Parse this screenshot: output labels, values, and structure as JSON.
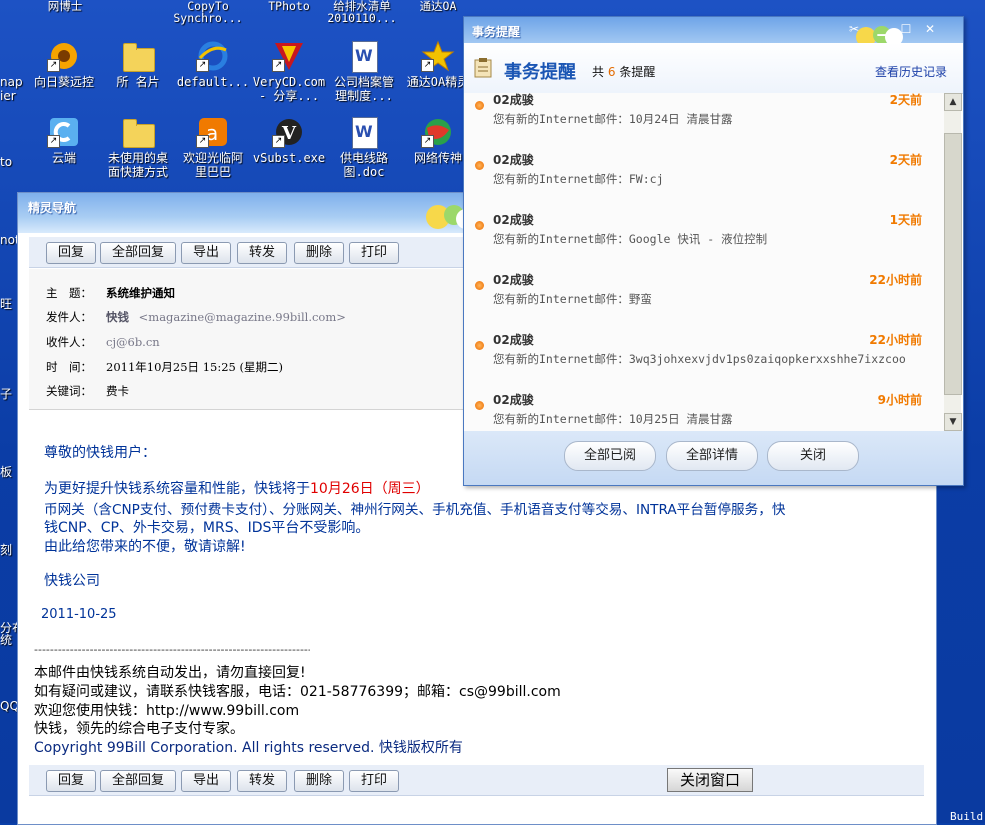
{
  "desktop": {
    "top_labels": [
      "网博士",
      "CopyTo\nSynchro...",
      "TPhoto",
      "给排水清单\n2010110...",
      "通达OA"
    ],
    "icons": [
      {
        "label": "向日葵远控",
        "icon": "sunflower-icon"
      },
      {
        "label": "所 名片",
        "icon": "folder-icon"
      },
      {
        "label": "default...",
        "icon": "ie-icon"
      },
      {
        "label": "VeryCD.com\n- 分享...",
        "icon": "verycd-icon"
      },
      {
        "label": "公司档案管\n理制度...",
        "icon": "word-doc-icon"
      },
      {
        "label": "通达OA精灵",
        "icon": "star-icon"
      },
      {
        "label": "云端",
        "icon": "cloud-app-icon"
      },
      {
        "label": "未使用的桌\n面快捷方式",
        "icon": "folder-icon"
      },
      {
        "label": "欢迎光临阿\n里巴巴",
        "icon": "alibaba-icon"
      },
      {
        "label": "vSubst.exe",
        "icon": "vsubst-icon"
      },
      {
        "label": "供电线路\n图.doc",
        "icon": "word-doc-icon"
      },
      {
        "label": "网络传神",
        "icon": "globe-icon"
      }
    ],
    "edge_labels": [
      "nap",
      "ier",
      "to",
      "not",
      "旺",
      "子",
      "板",
      "刻",
      "分布\n统",
      "QQ"
    ],
    "corner_text": "Build"
  },
  "mail_window": {
    "title": "精灵导航",
    "toolbar": [
      "回复",
      "全部回复",
      "导出",
      "转发",
      "删除",
      "打印"
    ],
    "header": {
      "subject_label": "主　题：",
      "subject": "系统维护通知",
      "from_label": "发件人：",
      "from_name": "快钱",
      "from_email": "<magazine@magazine.99bill.com>",
      "to_label": "收件人：",
      "to": "cj@6b.cn",
      "time_label": "时　间：",
      "time": "2011年10月25日 15:25 (星期二)",
      "keyword_label": "关键词：",
      "keyword": "费卡"
    },
    "body": {
      "greeting": "尊敬的快钱用户：",
      "para_1_line_1a": "为更好提升快钱系统容量和性能，快钱将于",
      "para_1_line_1b": "10月26日（周三）",
      "para_1_line_2": "币网关（含CNP支付、预付费卡支付）、分账网关、神州行网关、手机充值、手机语音支付等交易、INTRA平台暂停服务，快",
      "para_1_line_3": "钱CNP、CP、外卡交易，MRS、IDS平台不受影响。",
      "para_2": "由此给您带来的不便，敬请谅解!",
      "company": "快钱公司",
      "date": "2011-10-25",
      "separator": "------------------------------------------------------------------------",
      "footer_1": " 本邮件由快钱系统自动发出，请勿直接回复!",
      "footer_2": "如有疑问或建议，请联系快钱客服，电话：021-58776399；邮箱：cs@99bill.com",
      "footer_3": "欢迎您使用快钱：http://www.99bill.com",
      "footer_4": "快钱，领先的综合电子支付专家。",
      "footer_5": "Copyright 99Bill Corporation. All rights reserved. 快钱版权所有"
    },
    "bottom_toolbar": [
      "回复",
      "全部回复",
      "导出",
      "转发",
      "删除",
      "打印"
    ],
    "close_window": "关闭窗口"
  },
  "popup": {
    "title": "事务提醒",
    "heading": "事务提醒",
    "count_prefix": "共",
    "count": "6",
    "count_suffix": "条提醒",
    "history_link": "查看历史记录",
    "items": [
      {
        "sender": "02成骏",
        "message": "您有新的Internet邮件：10月24日 清晨甘露",
        "ago": "2天前"
      },
      {
        "sender": "02成骏",
        "message": "您有新的Internet邮件：FW:cj",
        "ago": "2天前"
      },
      {
        "sender": "02成骏",
        "message": "您有新的Internet邮件：Google 快讯 - 液位控制",
        "ago": "1天前"
      },
      {
        "sender": "02成骏",
        "message": "您有新的Internet邮件：野蛮",
        "ago": "22小时前"
      },
      {
        "sender": "02成骏",
        "message": "您有新的Internet邮件：3wq3johxexvjdv1ps0zaiqopkerxxshhe7ixzcoo",
        "ago": "22小时前"
      },
      {
        "sender": "02成骏",
        "message": "您有新的Internet邮件：10月25日 清晨甘露",
        "ago": "9小时前"
      }
    ],
    "buttons": [
      "全部已阅",
      "全部详情",
      "关闭"
    ]
  }
}
